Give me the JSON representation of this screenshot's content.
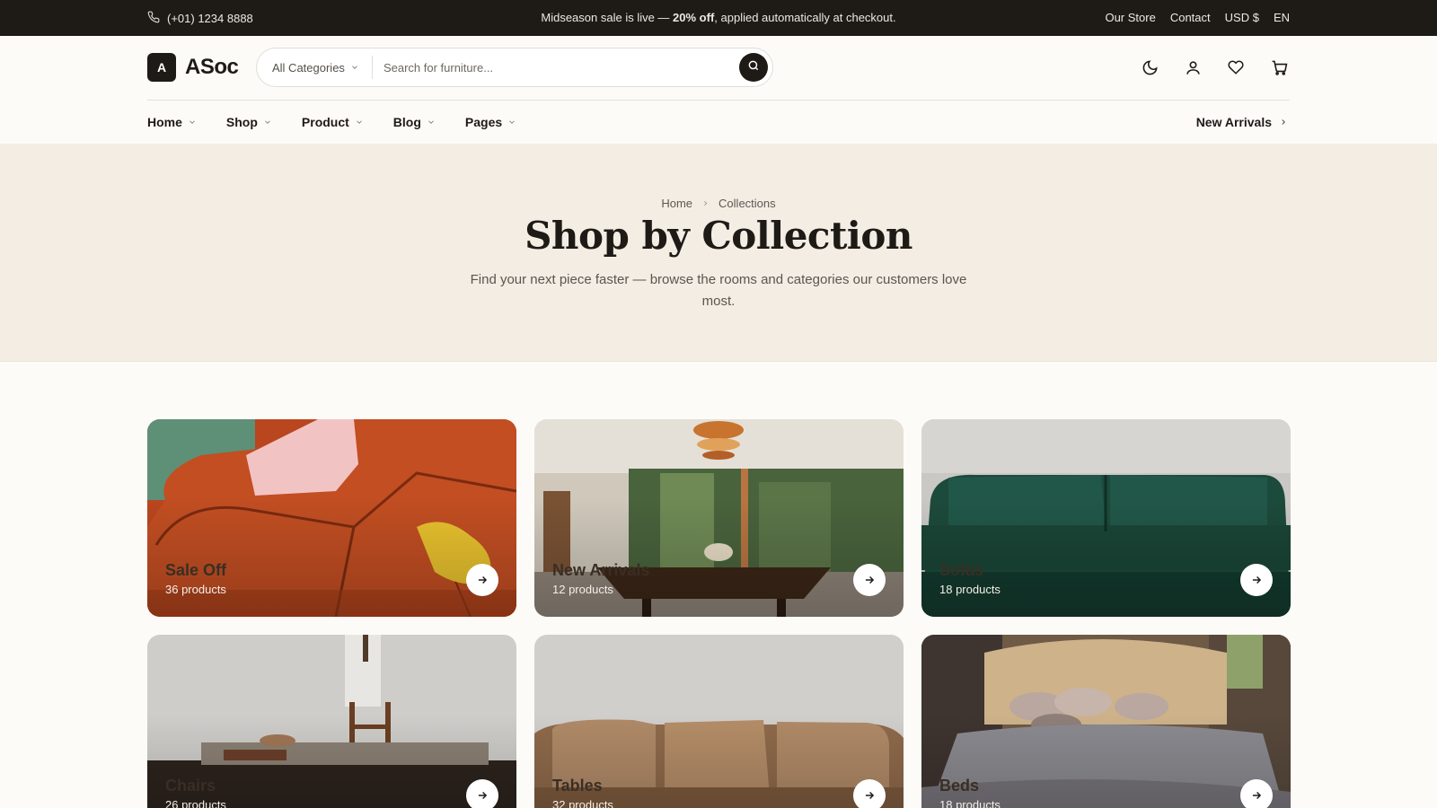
{
  "topbar": {
    "phone": "(+01) 1234 8888",
    "promo_prefix": "Midseason sale is live — ",
    "promo_bold": "20% off",
    "promo_suffix": ", applied automatically at checkout.",
    "links": [
      "Our Store",
      "Contact",
      "USD $",
      "EN"
    ]
  },
  "brand": {
    "mark": "A",
    "name": "ASoc"
  },
  "search": {
    "category": "All Categories",
    "placeholder": "Search for furniture..."
  },
  "header_icons": [
    "moon-icon",
    "user-icon",
    "heart-icon",
    "cart-icon"
  ],
  "nav": {
    "items": [
      "Home",
      "Shop",
      "Product",
      "Blog",
      "Pages"
    ],
    "new_arrivals": "New Arrivals"
  },
  "hero": {
    "breadcrumb": [
      "Home",
      "Collections"
    ],
    "title": "Shop by Collection",
    "subtitle": "Find your next piece faster — browse the rooms and categories our customers love most."
  },
  "collections": [
    {
      "title": "Sale Off",
      "count": "36 products"
    },
    {
      "title": "New Arrivals",
      "count": "12 products"
    },
    {
      "title": "Sofas",
      "count": "18 products"
    },
    {
      "title": "Chairs",
      "count": "26 products"
    },
    {
      "title": "Tables",
      "count": "32 products"
    },
    {
      "title": "Beds",
      "count": "18 products"
    }
  ],
  "colors": {
    "topbar_bg": "#1e1a16",
    "hero_bg": "#f3ede4",
    "page_bg": "#fcfbf8"
  }
}
